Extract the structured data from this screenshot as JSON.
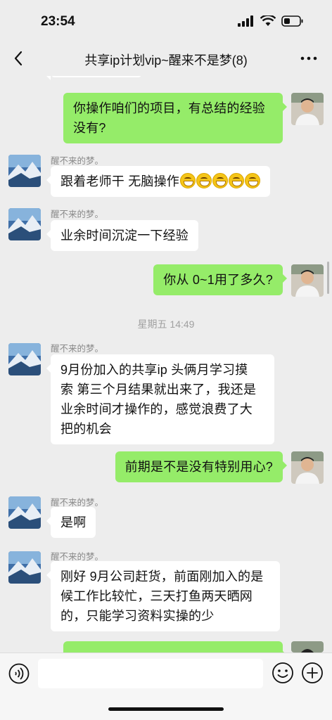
{
  "status": {
    "time": "23:54"
  },
  "header": {
    "title": "共享ip计划vip~醒来不是梦(8)"
  },
  "icons": {
    "back": "chevron-left-icon",
    "more": "more-dots-icon",
    "voice": "voice-icon",
    "emoji": "emoji-smile-icon",
    "plus": "plus-circle-icon"
  },
  "colors": {
    "background": "#ededed",
    "outgoing_bubble": "#95ec69",
    "incoming_bubble": "#ffffff"
  },
  "messages": [
    {
      "line1": "你操作咱们的项目，有总结的经验",
      "line2": "没有?"
    },
    {
      "sender": "醒不来的梦。",
      "text": "跟着老师干 无脑操作",
      "emoji_count": 5
    },
    {
      "sender": "醒不来的梦。",
      "text": "业余时间沉淀一下经验"
    },
    {
      "text": "你从 0~1用了多久?"
    },
    {
      "timestamp": "星期五 14:49"
    },
    {
      "sender": "醒不来的梦。",
      "lines": [
        "9月份加入的共享ip  头俩月学习摸",
        "索 第三个月结果就出来了，我还是",
        "业余时间才操作的，感觉浪费了大",
        "把的机会"
      ]
    },
    {
      "text": "前期是不是没有特别用心?"
    },
    {
      "sender": "醒不来的梦。",
      "text": "是啊"
    },
    {
      "sender": "醒不来的梦。",
      "lines": [
        "刚好 9月公司赶货，前面刚加入的是",
        "候工作比较忙，三天打鱼两天晒网",
        "的，只能学习资料实操的少"
      ]
    }
  ],
  "input": {
    "value": "",
    "placeholder": ""
  }
}
